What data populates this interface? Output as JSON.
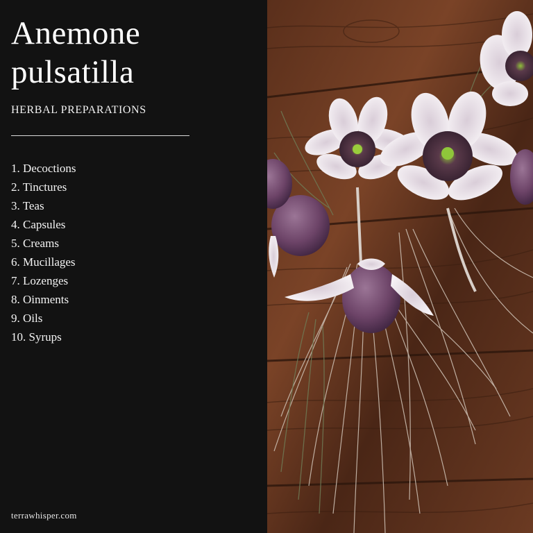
{
  "header": {
    "title_line1": "Anemone",
    "title_line2": "pulsatilla",
    "subtitle": "HERBAL PREPARATIONS"
  },
  "preparations": [
    "1. Decoctions",
    "2. Tinctures",
    "3. Teas",
    "4. Capsules",
    "5. Creams",
    "6. Mucillages",
    "7. Lozenges",
    "8. Oinments",
    "9. Oils",
    "10. Syrups"
  ],
  "footer": {
    "site": "terrawhisper.com"
  },
  "photo": {
    "subject": "pasque-flower-photo",
    "colors": {
      "panel_background": "#121212",
      "wood_dark": "#3b2015",
      "wood_mid": "#6b3a22",
      "wood_light": "#8a4e2c",
      "petal": "#efe7ee",
      "bud": "#6f4a6c",
      "root": "#cdbfb2"
    }
  }
}
